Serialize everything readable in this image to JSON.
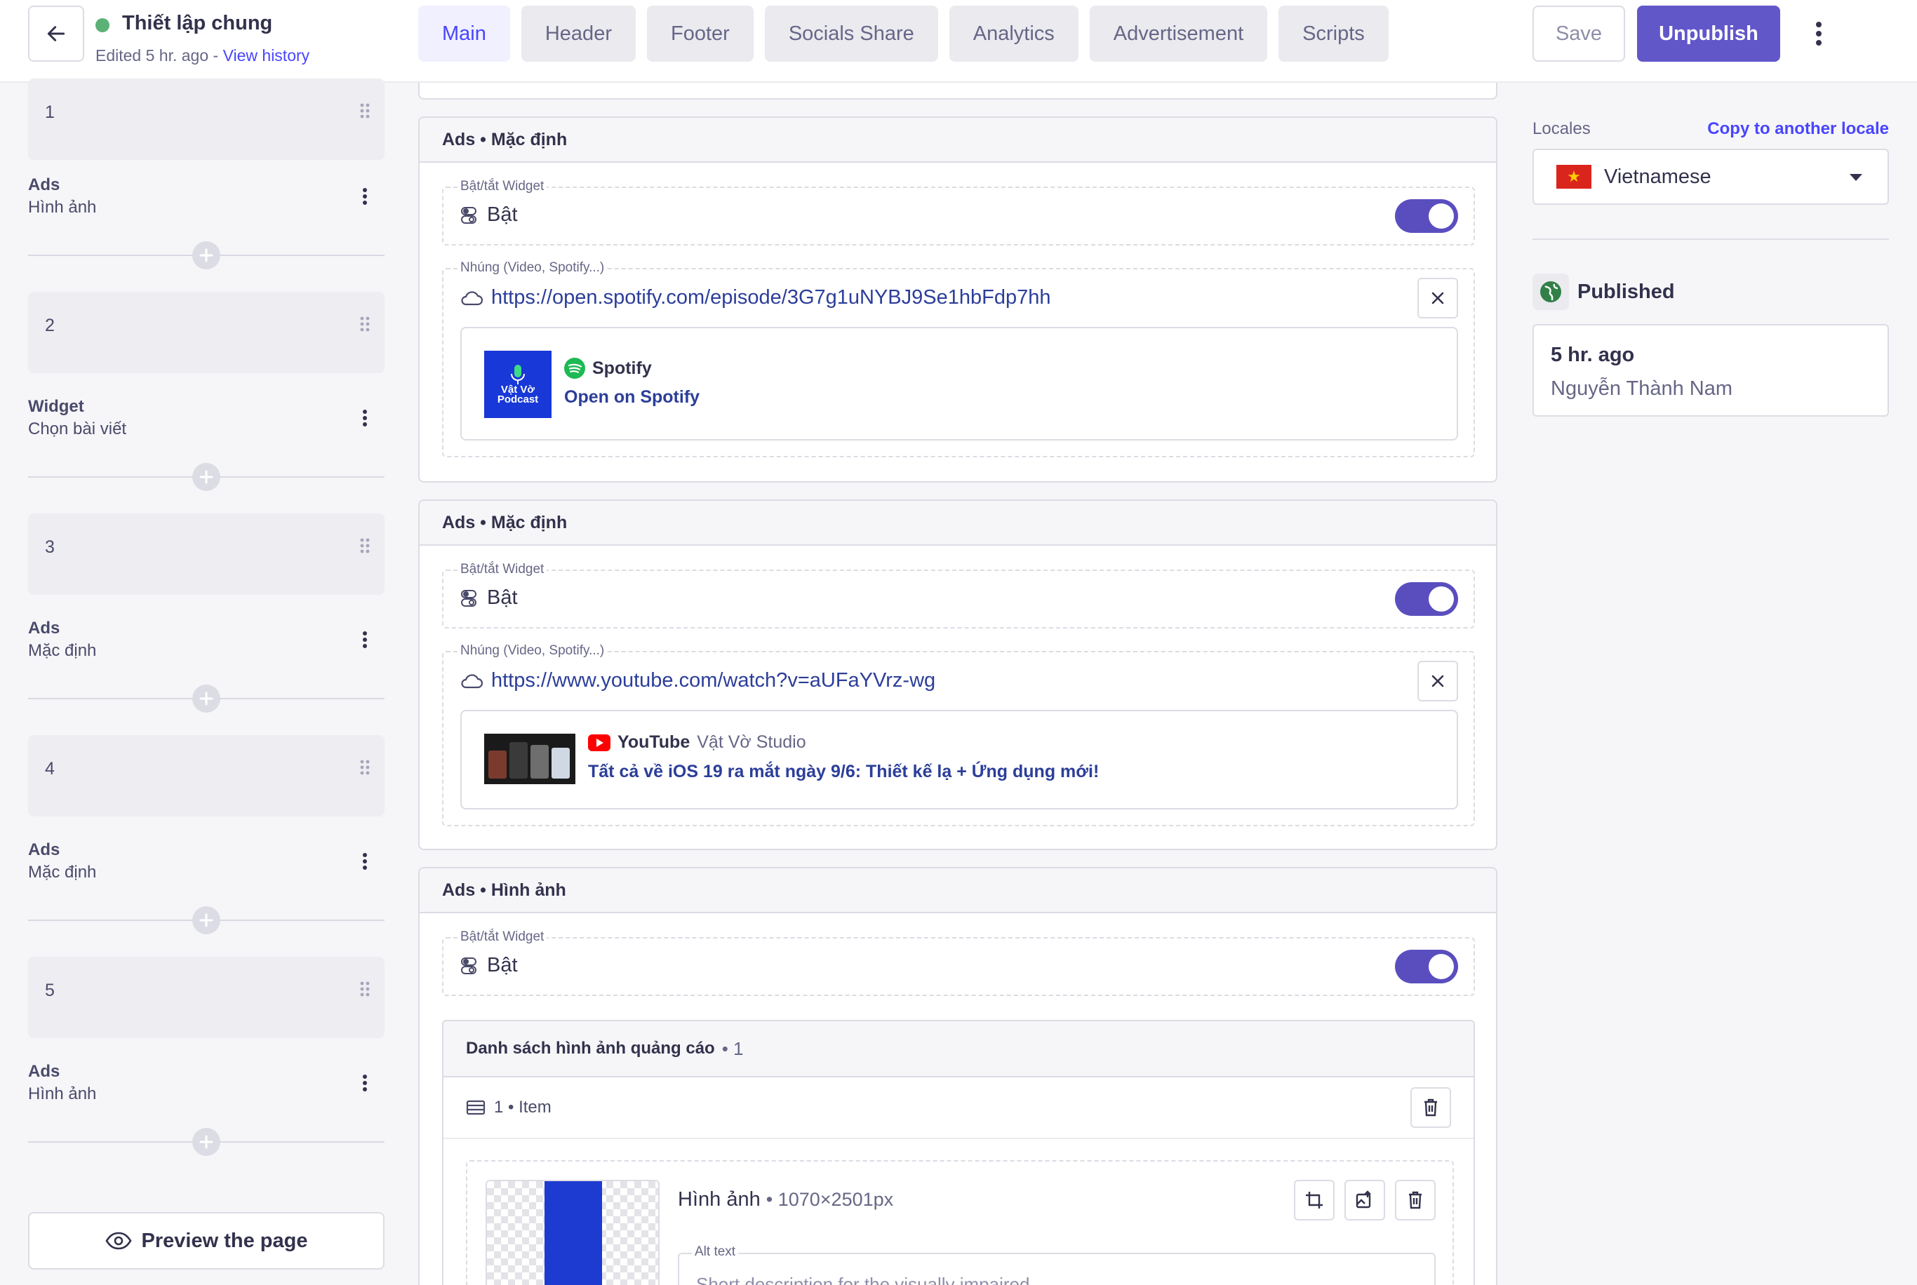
{
  "header": {
    "title": "Thiết lập chung",
    "edited": "Edited 5 hr. ago - ",
    "view_history": "View history",
    "tabs": [
      "Main",
      "Header",
      "Footer",
      "Socials Share",
      "Analytics",
      "Advertisement",
      "Scripts"
    ],
    "save": "Save",
    "unpublish": "Unpublish"
  },
  "sidebar": {
    "blocks": [
      {
        "num": "1",
        "type": "Ads",
        "sub": "Hình ảnh"
      },
      {
        "num": "2",
        "type": "Widget",
        "sub": "Chọn bài viết"
      },
      {
        "num": "3",
        "type": "Ads",
        "sub": "Mặc định"
      },
      {
        "num": "4",
        "type": "Ads",
        "sub": "Mặc định"
      },
      {
        "num": "5",
        "type": "Ads",
        "sub": "Hình ảnh"
      }
    ],
    "preview": "Preview the page"
  },
  "main": {
    "panels": [
      {
        "title": "Ads • Mặc định",
        "toggle_legend": "Bật/tắt Widget",
        "toggle_value": "Bật",
        "embed_legend": "Nhúng (Video, Spotify...)",
        "url": "https://open.spotify.com/episode/3G7g1uNYBJ9Se1hbFdp7hh",
        "provider": "Spotify",
        "link": "Open on Spotify",
        "thumb_text": "Vật Vờ Podcast"
      },
      {
        "title": "Ads • Mặc định",
        "toggle_legend": "Bật/tắt Widget",
        "toggle_value": "Bật",
        "embed_legend": "Nhúng (Video, Spotify...)",
        "url": "https://www.youtube.com/watch?v=aUFaYVrz-wg",
        "provider": "YouTube",
        "author": "Vật Vờ Studio",
        "link": "Tất cả về iOS 19 ra mắt ngày 9/6: Thiết kế lạ + Ứng dụng mới!"
      },
      {
        "title": "Ads • Hình ảnh",
        "toggle_legend": "Bật/tắt Widget",
        "toggle_value": "Bật",
        "list_title": "Danh sách hình ảnh quảng cáo",
        "list_count": "• 1",
        "item_label": "1 • Item",
        "image_title": "Hình ảnh",
        "image_dims": "• 1070×2501px",
        "alt_legend": "Alt text",
        "alt_placeholder": "Short description for the visually impaired"
      }
    ]
  },
  "right": {
    "locales_label": "Locales",
    "copy_locale": "Copy to another locale",
    "locale": "Vietnamese",
    "status": "Published",
    "time": "5 hr. ago",
    "user": "Nguyễn Thành Nam"
  },
  "colors": {
    "primary": "#4945ff",
    "button": "#6257c9",
    "toggle": "#5a4ebf",
    "published": "#5cb176"
  }
}
